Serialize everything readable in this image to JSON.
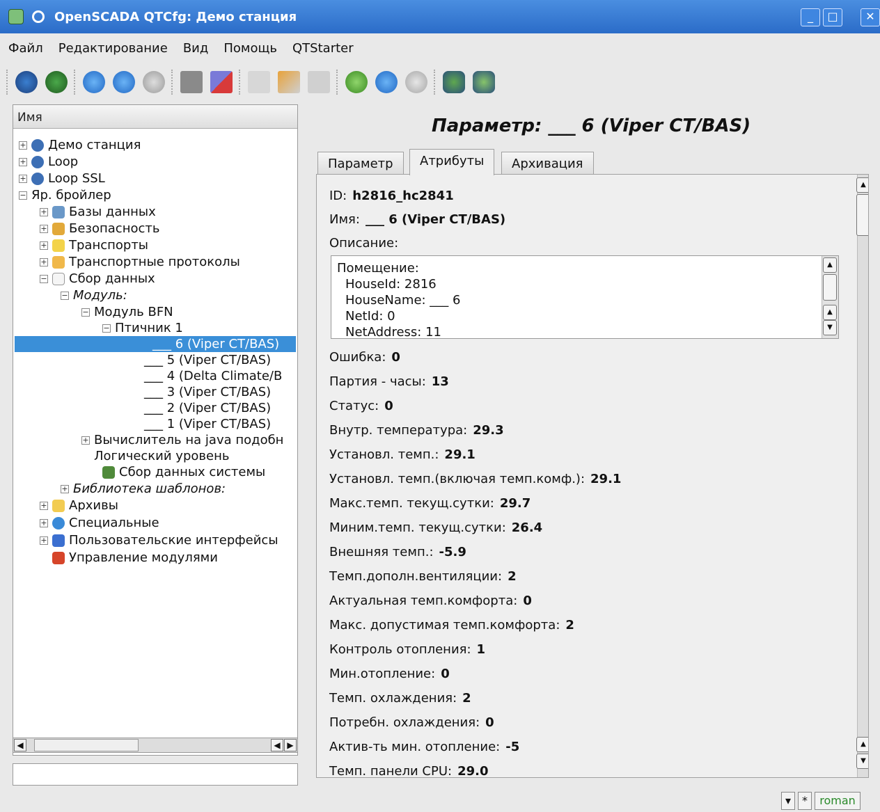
{
  "window": {
    "title": "OpenSCADA QTCfg: Демо станция",
    "min": "_",
    "max": "□",
    "close": "✕"
  },
  "menu": [
    "Файл",
    "Редактирование",
    "Вид",
    "Помощь",
    "QTStarter"
  ],
  "toolbar_icons": [
    "db-load-icon",
    "db-save-icon",
    "up-icon",
    "back-icon",
    "forward-icon",
    "add-item-icon",
    "delete-item-icon",
    "copy-icon",
    "cut-icon",
    "paste-icon",
    "refresh-icon",
    "start-icon",
    "stop-icon",
    "station-icon",
    "station2-icon"
  ],
  "tree": {
    "header": "Имя",
    "nodes": [
      {
        "label": "Демо станция"
      },
      {
        "label": "Loop"
      },
      {
        "label": "Loop SSL"
      },
      {
        "label": "Яр. бройлер"
      },
      {
        "label": "Базы данных"
      },
      {
        "label": "Безопасность"
      },
      {
        "label": "Транспорты"
      },
      {
        "label": "Транспортные протоколы"
      },
      {
        "label": "Сбор данных"
      },
      {
        "label": "Модуль:"
      },
      {
        "label": "Модуль BFN"
      },
      {
        "label": "Птичник 1"
      },
      {
        "label": "___ 6 (Viper CT/BAS)"
      },
      {
        "label": "___ 5 (Viper CT/BAS)"
      },
      {
        "label": "___ 4 (Delta Climate/B"
      },
      {
        "label": "___ 3 (Viper CT/BAS)"
      },
      {
        "label": "___ 2 (Viper CT/BAS)"
      },
      {
        "label": "___ 1 (Viper CT/BAS)"
      },
      {
        "label": "Вычислитель на java подобн"
      },
      {
        "label": "Логический уровень"
      },
      {
        "label": "Сбор данных системы"
      },
      {
        "label": "Библиотека шаблонов:"
      },
      {
        "label": "Архивы"
      },
      {
        "label": "Специальные"
      },
      {
        "label": "Пользовательские интерфейсы"
      },
      {
        "label": "Управление модулями"
      }
    ]
  },
  "panel": {
    "title": "Параметр: ___ 6 (Viper CT/BAS)",
    "tabs": [
      "Параметр",
      "Атрибуты",
      "Архивация"
    ],
    "id_label": "ID:",
    "id_value": "h2816_hc2841",
    "name_label": "Имя:",
    "name_value": "___ 6 (Viper CT/BAS)",
    "desc_label": "Описание:",
    "desc_lines": [
      "Помещение:",
      "  HouseId: 2816",
      "  HouseName: ___ 6",
      "  NetId: 0",
      "  NetAddress: 11"
    ],
    "attrs": [
      {
        "label": "Ошибка:",
        "value": "0"
      },
      {
        "label": "Партия - часы:",
        "value": "13"
      },
      {
        "label": "Статус:",
        "value": "0"
      },
      {
        "label": "Внутр. температура:",
        "value": "29.3"
      },
      {
        "label": "Установл. темп.:",
        "value": "29.1"
      },
      {
        "label": "Установл. темп.(включая темп.комф.):",
        "value": "29.1"
      },
      {
        "label": "Макс.темп. текущ.сутки:",
        "value": "29.7"
      },
      {
        "label": "Миним.темп. текущ.сутки:",
        "value": "26.4"
      },
      {
        "label": "Внешняя темп.:",
        "value": "-5.9"
      },
      {
        "label": "Темп.дополн.вентиляции:",
        "value": "2"
      },
      {
        "label": "Актуальная темп.комфорта:",
        "value": "0"
      },
      {
        "label": "Макс. допустимая темп.комфорта:",
        "value": "2"
      },
      {
        "label": "Контроль отопления:",
        "value": "1"
      },
      {
        "label": "Мин.отопление:",
        "value": "0"
      },
      {
        "label": "Темп. охлаждения:",
        "value": "2"
      },
      {
        "label": "Потребн. охлаждения:",
        "value": "0"
      },
      {
        "label": "Актив-ть мин. отопление:",
        "value": "-5"
      },
      {
        "label": "Темп. панели CPU:",
        "value": "29.0"
      }
    ]
  },
  "status": {
    "flag": "*",
    "user": "roman"
  }
}
